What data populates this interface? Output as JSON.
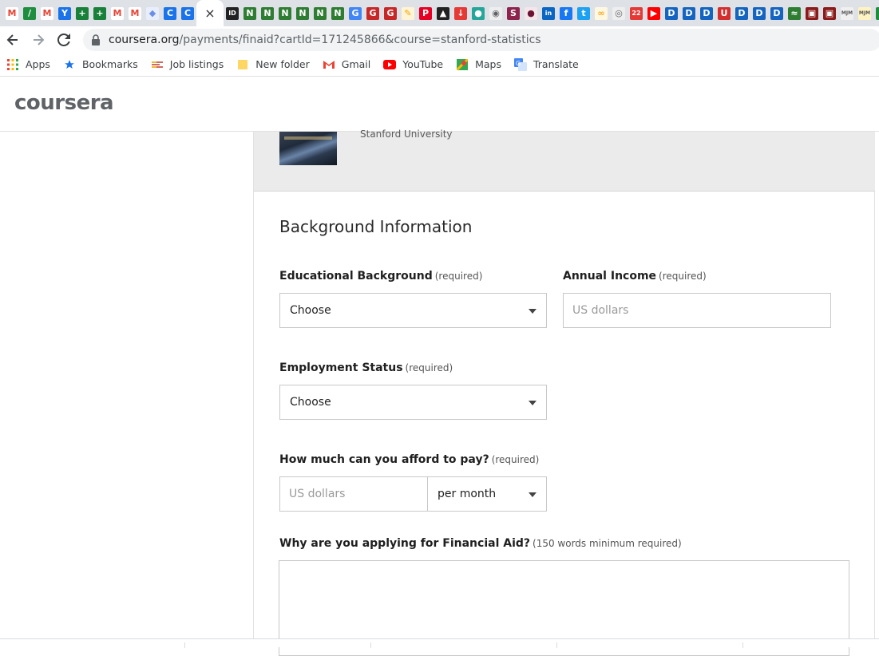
{
  "browser": {
    "tabs": {
      "favicons": [
        {
          "glyph": "M",
          "color": "#ea4335",
          "bg": "#ffffff",
          "name": "gmail-icon"
        },
        {
          "glyph": "/",
          "color": "#ffffff",
          "bg": "#1e8e3e",
          "name": "pen-icon"
        },
        {
          "glyph": "M",
          "color": "#ea4335",
          "bg": "#ffffff",
          "name": "gmail-icon"
        },
        {
          "glyph": "Y",
          "color": "#ffffff",
          "bg": "#1a73e8",
          "name": "yammer-icon"
        },
        {
          "glyph": "+",
          "color": "#ffffff",
          "bg": "#188038",
          "name": "plus-green-icon"
        },
        {
          "glyph": "+",
          "color": "#ffffff",
          "bg": "#188038",
          "name": "plus-green-icon"
        },
        {
          "glyph": "M",
          "color": "#ea4335",
          "bg": "#ffffff",
          "name": "gmail-icon"
        },
        {
          "glyph": "M",
          "color": "#ea4335",
          "bg": "#ffffff",
          "name": "gmail-icon"
        },
        {
          "glyph": "◆",
          "color": "#6c8ee6",
          "bg": "#e8eefc",
          "name": "diamond-icon"
        },
        {
          "glyph": "C",
          "color": "#ffffff",
          "bg": "#1a73e8",
          "name": "coursera-c-icon"
        },
        {
          "glyph": "C",
          "color": "#ffffff",
          "bg": "#1a73e8",
          "name": "coursera-c-icon"
        }
      ],
      "active_close": "×",
      "favicons_after": [
        {
          "glyph": "ID",
          "color": "#ffffff",
          "bg": "#222222",
          "name": "id-icon"
        },
        {
          "glyph": "N",
          "color": "#ffffff",
          "bg": "#2e7d32",
          "name": "n-green-icon"
        },
        {
          "glyph": "N",
          "color": "#ffffff",
          "bg": "#2e7d32",
          "name": "n-green-icon"
        },
        {
          "glyph": "N",
          "color": "#ffffff",
          "bg": "#2e7d32",
          "name": "n-green-icon"
        },
        {
          "glyph": "N",
          "color": "#ffffff",
          "bg": "#2e7d32",
          "name": "n-green-icon"
        },
        {
          "glyph": "N",
          "color": "#ffffff",
          "bg": "#2e7d32",
          "name": "n-green-icon"
        },
        {
          "glyph": "N",
          "color": "#ffffff",
          "bg": "#2e7d32",
          "name": "n-green-icon"
        },
        {
          "glyph": "G",
          "color": "#ffffff",
          "bg": "#4285f4",
          "name": "g-circle-icon"
        },
        {
          "glyph": "G",
          "color": "#ffffff",
          "bg": "#c62828",
          "name": "g-red-icon"
        },
        {
          "glyph": "G",
          "color": "#ffffff",
          "bg": "#c62828",
          "name": "g-red-icon"
        },
        {
          "glyph": "✎",
          "color": "#f2a600",
          "bg": "#fff4d6",
          "name": "pencil-icon"
        },
        {
          "glyph": "P",
          "color": "#ffffff",
          "bg": "#e60023",
          "name": "pinterest-icon"
        },
        {
          "glyph": "▲",
          "color": "#ffffff",
          "bg": "#222222",
          "name": "upload-icon"
        },
        {
          "glyph": "↓",
          "color": "#ffffff",
          "bg": "#e53935",
          "name": "download-icon"
        },
        {
          "glyph": "●",
          "color": "#ffffff",
          "bg": "#26a69a",
          "name": "chat-icon"
        },
        {
          "glyph": "◉",
          "color": "#5f6368",
          "bg": "#eeeeee",
          "name": "globe-icon"
        },
        {
          "glyph": "S",
          "color": "#ffffff",
          "bg": "#8e244d",
          "name": "s-maroon-icon"
        },
        {
          "glyph": "●",
          "color": "#6b1232",
          "bg": "#f5e6ea",
          "name": "dot-maroon-icon"
        },
        {
          "glyph": "in",
          "color": "#ffffff",
          "bg": "#0a66c2",
          "name": "linkedin-icon"
        },
        {
          "glyph": "f",
          "color": "#ffffff",
          "bg": "#1877f2",
          "name": "facebook-icon"
        },
        {
          "glyph": "t",
          "color": "#ffffff",
          "bg": "#1da1f2",
          "name": "twitter-icon"
        },
        {
          "glyph": "∞",
          "color": "#f9a825",
          "bg": "#fff8e1",
          "name": "loop-icon"
        },
        {
          "glyph": "◎",
          "color": "#5f6368",
          "bg": "#eeeeee",
          "name": "world-icon"
        },
        {
          "glyph": "22",
          "color": "#ffffff",
          "bg": "#e53935",
          "name": "messenger-badge-icon"
        },
        {
          "glyph": "▶",
          "color": "#ffffff",
          "bg": "#ff0000",
          "name": "youtube-icon"
        },
        {
          "glyph": "D",
          "color": "#ffffff",
          "bg": "#1565c0",
          "name": "d-blue-icon"
        },
        {
          "glyph": "D",
          "color": "#ffffff",
          "bg": "#1565c0",
          "name": "d-blue-icon"
        },
        {
          "glyph": "D",
          "color": "#ffffff",
          "bg": "#1565c0",
          "name": "d-blue-icon"
        },
        {
          "glyph": "U",
          "color": "#ffffff",
          "bg": "#d32f2f",
          "name": "u-red-icon"
        },
        {
          "glyph": "D",
          "color": "#ffffff",
          "bg": "#1565c0",
          "name": "d-blue-icon"
        },
        {
          "glyph": "D",
          "color": "#ffffff",
          "bg": "#1565c0",
          "name": "d-blue-icon"
        },
        {
          "glyph": "D",
          "color": "#ffffff",
          "bg": "#1565c0",
          "name": "d-blue-icon"
        },
        {
          "glyph": "≈",
          "color": "#ffffff",
          "bg": "#2e7d32",
          "name": "leaf-icon"
        },
        {
          "glyph": "▣",
          "color": "#ffffff",
          "bg": "#8b1a1a",
          "name": "crest-icon"
        },
        {
          "glyph": "▣",
          "color": "#ffffff",
          "bg": "#8b1a1a",
          "name": "crest-icon"
        },
        {
          "glyph": "MJM",
          "color": "#555555",
          "bg": "#f0f0f0",
          "name": "mjm-icon"
        },
        {
          "glyph": "MJM",
          "color": "#555555",
          "bg": "#fff3c4",
          "name": "mjm-icon"
        },
        {
          "glyph": "!",
          "color": "#ffffff",
          "bg": "#1e8e3e",
          "name": "alert-green-icon"
        }
      ]
    },
    "address": {
      "host": "coursera.org",
      "path": "/payments/finaid?cartId=171245866&course=stanford-statistics"
    },
    "bookmarks": [
      {
        "label": "Apps",
        "icon": "apps-grid-icon"
      },
      {
        "label": "Bookmarks",
        "icon": "star-icon"
      },
      {
        "label": "Job listings",
        "icon": "job-listings-icon"
      },
      {
        "label": "New folder",
        "icon": "folder-icon"
      },
      {
        "label": "Gmail",
        "icon": "gmail-icon"
      },
      {
        "label": "YouTube",
        "icon": "youtube-icon"
      },
      {
        "label": "Maps",
        "icon": "maps-icon"
      },
      {
        "label": "Translate",
        "icon": "translate-icon"
      }
    ]
  },
  "site": {
    "logo": "coursera"
  },
  "course": {
    "university": "Stanford University"
  },
  "form": {
    "title": "Background Information",
    "required_tag": "(required)",
    "education": {
      "label": "Educational Background",
      "value": "Choose"
    },
    "income": {
      "label": "Annual Income",
      "placeholder": "US dollars"
    },
    "employment": {
      "label": "Employment Status",
      "value": "Choose"
    },
    "afford": {
      "label": "How much can you afford to pay?",
      "placeholder": "US dollars",
      "period": "per month"
    },
    "why": {
      "label": "Why are you applying for Financial Aid?",
      "note": "(150 words minimum required)"
    }
  },
  "colors": {
    "tabstrip": "#dee1e6",
    "banner": "#ebebeb",
    "border": "#c8c8c8"
  }
}
